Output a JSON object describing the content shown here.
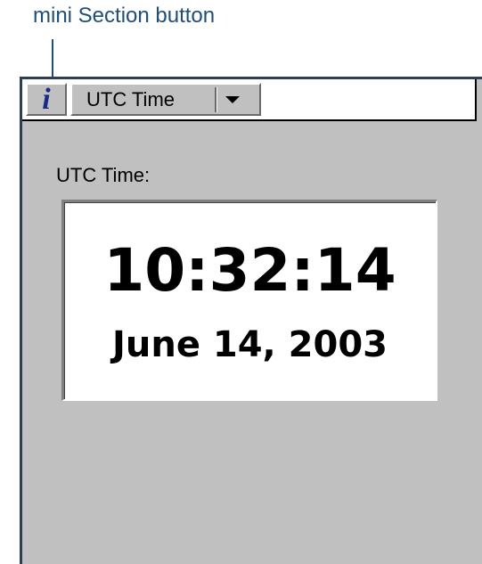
{
  "annotation": {
    "label": "mini Section button"
  },
  "toolbar": {
    "mini_section_icon": "info-icon",
    "section_dropdown": {
      "selected": "UTC Time",
      "icon": "chevron-down-icon"
    }
  },
  "content": {
    "field_label": "UTC Time:",
    "time": "10:32:14",
    "date": "June 14, 2003"
  },
  "colors": {
    "annotation": "#1f4e79",
    "window_background": "#c0c0c0",
    "info_icon": "#1a2a8a"
  }
}
